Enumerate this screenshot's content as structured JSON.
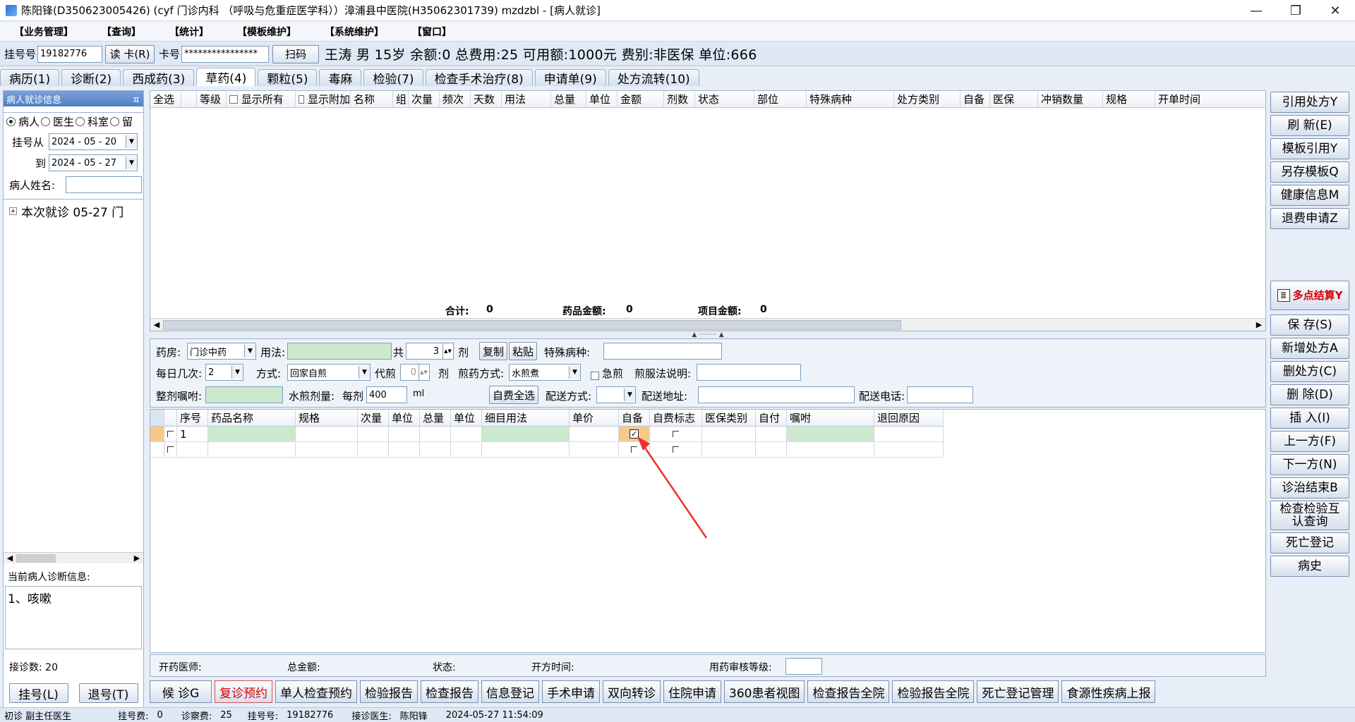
{
  "window": {
    "title": "陈阳锋(D350623005426) (cyf 门诊内科 （呼吸与危重症医学科））漳浦县中医院(H35062301739) mzdzbl - [病人就诊]",
    "minimize": "—",
    "restore": "❐",
    "close": "✕"
  },
  "menu": [
    "【业务管理】",
    "【查询】",
    "【统计】",
    "【模板维护】",
    "【系统维护】",
    "【窗口】"
  ],
  "infobar": {
    "reg_label": "挂号号",
    "reg_value": "19182776",
    "read_card": "读 卡(R)",
    "card_label": "卡号",
    "card_value": "****************",
    "scan": "扫码",
    "patient_line": "王涛 男 15岁 余额:0 总费用:25 可用额:1000元 费别:非医保 单位:666"
  },
  "tabs": [
    "病历(1)",
    "诊断(2)",
    "西成药(3)",
    "草药(4)",
    "颗粒(5)",
    "毒麻",
    "检验(7)",
    "检查手术治疗(8)",
    "申请单(9)",
    "处方流转(10)"
  ],
  "left": {
    "header": "病人就诊信息",
    "pin": "ㅍ",
    "radios": [
      "病人",
      "医生",
      "科室",
      "留"
    ],
    "from_label": "挂号从",
    "from_date": "2024 - 05 - 20",
    "to_label": "到",
    "to_date": "2024 - 05 - 27",
    "name_label": "病人姓名:",
    "tree_item": "本次就诊 05-27 门",
    "diag_label": "当前病人诊断信息:",
    "diag_text": "1、咳嗽",
    "visits": "接诊数: 20",
    "reg_btn": "挂号(L)",
    "unreg_btn": "退号(T)"
  },
  "upper_grid": {
    "headers": [
      "全选",
      "等级",
      "显示所有",
      "显示附加",
      "名称",
      "组",
      "次量",
      "频次",
      "天数",
      "用法",
      "总量",
      "单位",
      "金额",
      "剂数",
      "状态",
      "部位",
      "特殊病种",
      "处方类别",
      "自备",
      "医保",
      "冲销数量",
      "规格",
      "开单时间"
    ],
    "total_label": "合计:",
    "total_value": "0",
    "drug_amount_label": "药品金额:",
    "drug_amount_value": "0",
    "item_amount_label": "项目金额:",
    "item_amount_value": "0"
  },
  "form": {
    "pharmacy_label": "药房:",
    "pharmacy_value": "门诊中药",
    "usage_label": "用法:",
    "total_label": "共",
    "total_value": "3",
    "dose_unit": "剂",
    "copy": "复制",
    "paste": "粘贴",
    "special_label": "特殊病种:",
    "times_label": "每日几次:",
    "times_value": "2",
    "method_label": "方式:",
    "method_value": "回家自煎",
    "decoct_label": "代煎",
    "decoct_value": "0",
    "decoct_unit": "剂",
    "boil_label": "煎药方式:",
    "boil_value": "水煎煮",
    "urgent_label": "急煎",
    "boil_note_label": "煎服法说明:",
    "advice_label": "整剂嘱咐:",
    "water_label": "水煎剂量:",
    "per_dose_label": "每剂",
    "water_value": "400",
    "water_unit": "ml",
    "self_pay_all": "自费全选",
    "delivery_label": "配送方式:",
    "address_label": "配送地址:",
    "phone_label": "配送电话:"
  },
  "lower_grid": {
    "headers": [
      "序号",
      "药品名称",
      "规格",
      "次量",
      "单位",
      "总量",
      "单位",
      "细目用法",
      "单价",
      "自备",
      "自费标志",
      "医保类别",
      "自付",
      "嘱咐",
      "退回原因"
    ],
    "rows": [
      {
        "seq": "1"
      },
      {
        "seq": ""
      }
    ]
  },
  "footer": {
    "doctor_label": "开药医师:",
    "amount_label": "总金额:",
    "status_label": "状态:",
    "time_label": "开方时间:",
    "review_label": "用药审核等级:"
  },
  "right_buttons": [
    "引用处方Y",
    "刷 新(E)",
    "模板引用Y",
    "另存模板Q",
    "健康信息M",
    "退费申请Z"
  ],
  "settle_button": "多点结算Y",
  "right_buttons2": [
    "保 存(S)",
    "新增处方A",
    "删处方(C)",
    "删 除(D)",
    "插 入(I)",
    "上一方(F)",
    "下一方(N)",
    "诊治结束B",
    "检查检验互认查询",
    "死亡登记",
    "病史"
  ],
  "bottom_buttons": [
    "候 诊G",
    "复诊预约",
    "单人检查预约",
    "检验报告",
    "检查报告",
    "信息登记",
    "手术申请",
    "双向转诊",
    "住院申请",
    "360患者视图",
    "检查报告全院",
    "检验报告全院",
    "死亡登记管理",
    "食源性疾病上报"
  ],
  "status": {
    "title": "初诊 副主任医生",
    "fee_label": "挂号费:",
    "fee": "0",
    "consult_label": "诊察费:",
    "consult": "25",
    "reg_label": "挂号号:",
    "reg": "19182776",
    "doctor_label": "接诊医生:",
    "doctor": "陈阳锋",
    "datetime": "2024-05-27 11:54:09"
  },
  "colors": {
    "accent": "#4f7fc6",
    "green_cell": "#cde9cd",
    "arrow": "#e8322f",
    "settle_red": "#d40000"
  }
}
